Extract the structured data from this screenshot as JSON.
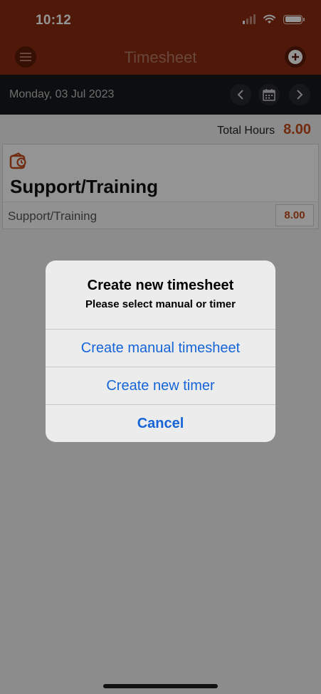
{
  "status_bar": {
    "time": "10:12"
  },
  "nav": {
    "title": "Timesheet"
  },
  "date_bar": {
    "date": "Monday, 03 Jul 2023"
  },
  "summary": {
    "total_label": "Total Hours",
    "total_value": "8.00"
  },
  "entry": {
    "title": "Support/Training",
    "sub_label": "Support/Training",
    "hours": "8.00",
    "icon": "timer-wallet-icon"
  },
  "dialog": {
    "title": "Create new timesheet",
    "message": "Please select manual or timer",
    "buttons": [
      "Create manual timesheet",
      "Create new timer",
      "Cancel"
    ]
  },
  "colors": {
    "brand": "#8a2a0f",
    "accent": "#c44a1a",
    "link": "#1565d8"
  }
}
